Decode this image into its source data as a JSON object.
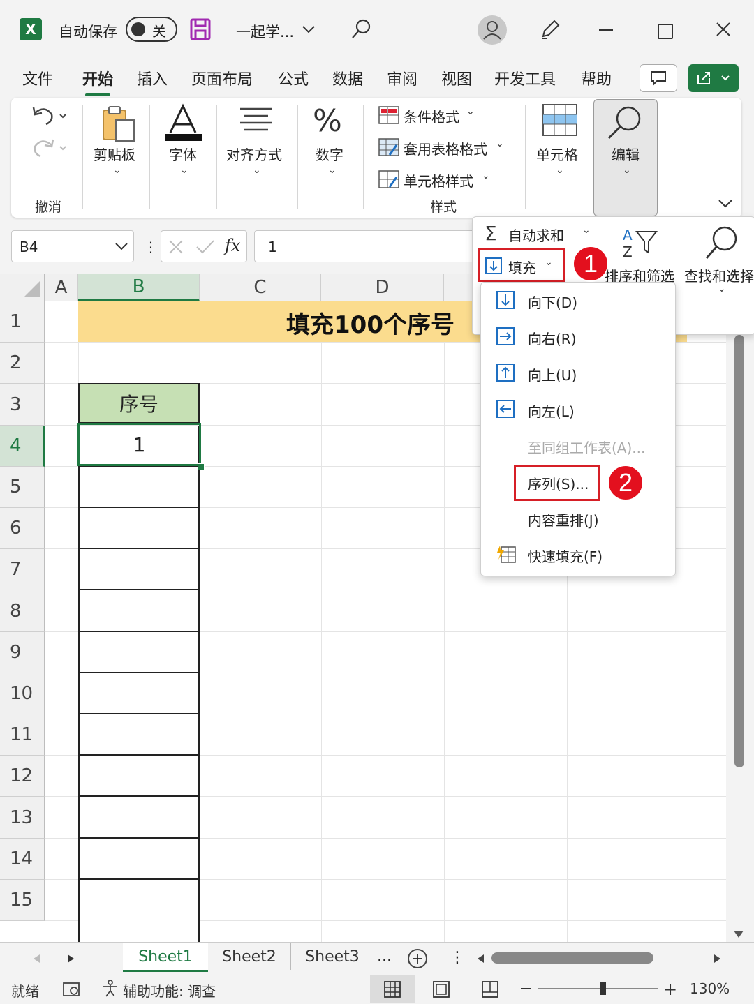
{
  "titlebar": {
    "autosave_label": "自动保存",
    "autosave_state": "关",
    "doc_name": "一起学...",
    "accent_color": "#1f7a43"
  },
  "tabs": [
    "文件",
    "开始",
    "插入",
    "页面布局",
    "公式",
    "数据",
    "审阅",
    "视图",
    "开发工具",
    "帮助"
  ],
  "active_tab": "开始",
  "ribbon": {
    "undo_group": "撤消",
    "clipboard": "剪贴板",
    "font": "字体",
    "align": "对齐方式",
    "number": "数字",
    "cond_format": "条件格式",
    "table_format": "套用表格格式",
    "cell_style": "单元格样式",
    "style_group": "样式",
    "cells": "单元格",
    "edit": "编辑"
  },
  "formula_bar": {
    "name_box": "B4",
    "fx": "fx",
    "value": "1"
  },
  "columns": [
    "A",
    "B",
    "C",
    "D"
  ],
  "rows": [
    "1",
    "2",
    "3",
    "4",
    "5",
    "6",
    "7",
    "8",
    "9",
    "10",
    "11",
    "12",
    "13",
    "14",
    "15"
  ],
  "sheet": {
    "title": "填充100个序号",
    "header": "序号",
    "b4_value": "1"
  },
  "edit_panel": {
    "autosum": "自动求和",
    "fill": "填充",
    "sort_filter": "排序和筛选",
    "find_select": "查找和选择"
  },
  "fill_menu": {
    "down": "向下(D)",
    "right": "向右(R)",
    "up": "向上(U)",
    "left": "向左(L)",
    "across_sheets": "至同组工作表(A)...",
    "series": "序列(S)...",
    "justify": "内容重排(J)",
    "flash_fill": "快速填充(F)"
  },
  "callouts": {
    "one": "1",
    "two": "2",
    "color": "#e3101e"
  },
  "sheet_tabs": [
    "Sheet1",
    "Sheet2",
    "Sheet3"
  ],
  "sheet_more": "...",
  "status": {
    "ready": "就绪",
    "accessibility": "辅助功能: 调查",
    "zoom": "130%"
  }
}
